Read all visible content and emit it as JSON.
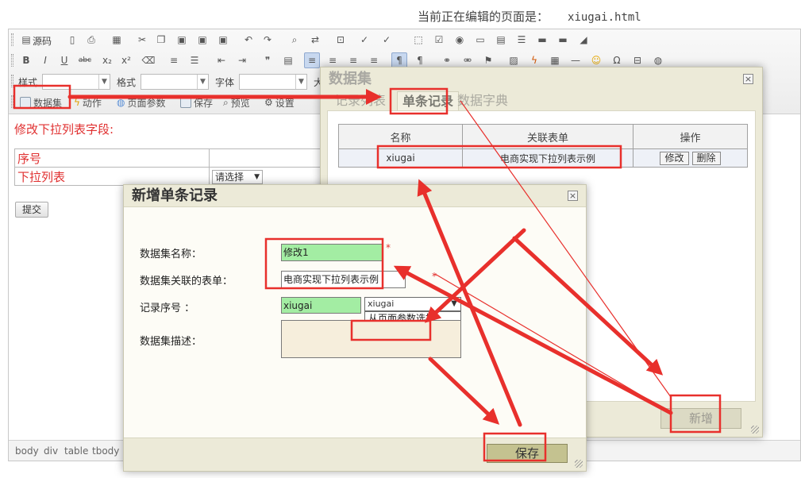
{
  "page": {
    "editing_label": "当前正在编辑的页面是：",
    "editing_file": "xiugai.html"
  },
  "toolbar": {
    "source_label": "源码",
    "style_label": "样式",
    "format_label": "格式",
    "font_label": "字体",
    "size_label": "大",
    "dataset_label": "数据集",
    "action_label": "动作",
    "page_params_label": "页面参数",
    "save_label": "保存",
    "preview_label": "预览",
    "settings_label": "设置"
  },
  "content": {
    "caption": "修改下拉列表字段:",
    "rows": [
      {
        "label": "序号"
      },
      {
        "label": "下拉列表",
        "select_value": "请选择"
      }
    ],
    "submit_label": "提交"
  },
  "statusbar": {
    "path": [
      "body",
      "div",
      "table",
      "tbody"
    ]
  },
  "dataset_dialog": {
    "title": "数据集",
    "tabs": [
      "记录列表",
      "单条记录",
      "数据字典"
    ],
    "active_tab": "单条记录",
    "columns": [
      "名称",
      "关联表单",
      "操作"
    ],
    "rows": [
      {
        "name": "xiugai",
        "form": "电商实现下拉列表示例",
        "actions": [
          "修改",
          "删除"
        ]
      }
    ],
    "add_label": "新增"
  },
  "new_record_dialog": {
    "title": "新增单条记录",
    "fields": {
      "name_label": "数据集名称：",
      "name_value": "修改1",
      "form_label": "数据集关联的表单：",
      "form_value": "电商实现下拉列表示例",
      "seq_label": "记录序号 ：",
      "seq_value": "xiugai",
      "seq_select_value": "xiugai",
      "seq_options": [
        "从页面参数选择",
        "xiugai"
      ],
      "desc_label": "数据集描述："
    },
    "required_mark": "*",
    "save_label": "保存"
  },
  "colors": {
    "annotation": "#e8302c",
    "field_highlight": "#a3eda3",
    "dialog_bg": "#ecead8",
    "option_selected": "#3399ff"
  },
  "icons": [
    "source-icon",
    "bold-icon",
    "italic-icon",
    "underline-icon",
    "dataset-icon",
    "action-icon",
    "page-params-icon",
    "save-icon",
    "preview-icon",
    "settings-icon",
    "close-icon",
    "resize-grip-icon",
    "dropdown-arrow-icon"
  ]
}
